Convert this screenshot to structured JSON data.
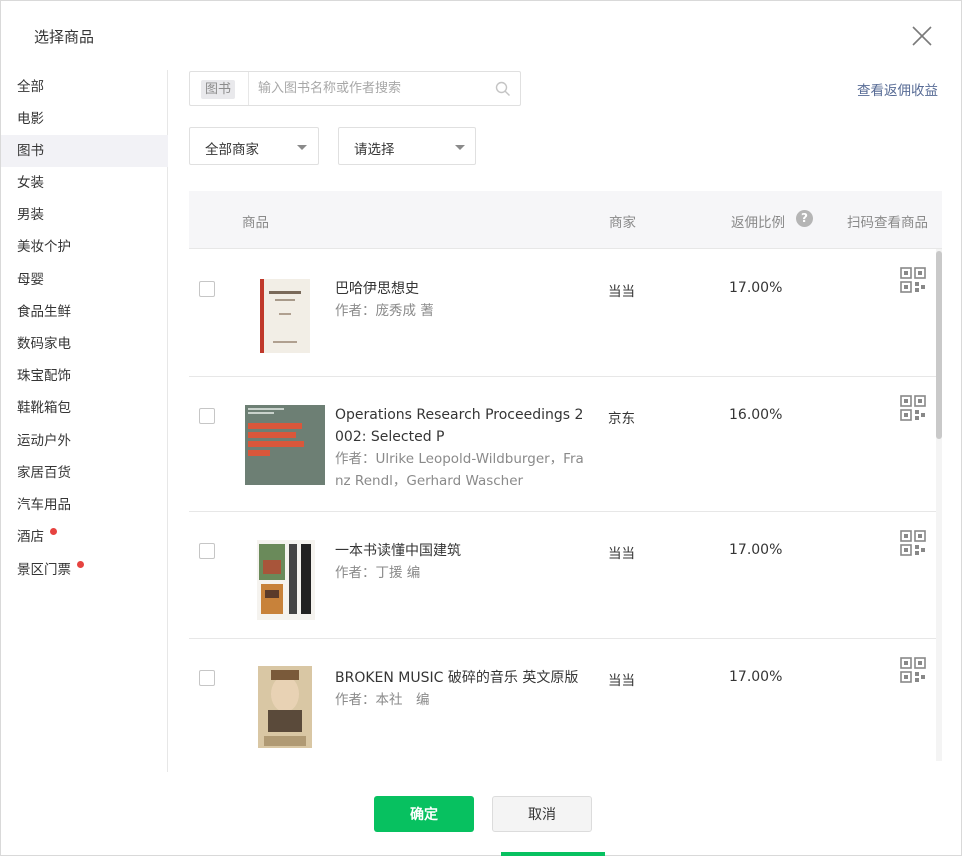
{
  "dialog": {
    "title": "选择商品",
    "confirm_label": "确定",
    "cancel_label": "取消"
  },
  "sidebar": {
    "items": [
      {
        "label": "全部",
        "active": false,
        "dot": false
      },
      {
        "label": "电影",
        "active": false,
        "dot": false
      },
      {
        "label": "图书",
        "active": true,
        "dot": false
      },
      {
        "label": "女装",
        "active": false,
        "dot": false
      },
      {
        "label": "男装",
        "active": false,
        "dot": false
      },
      {
        "label": "美妆个护",
        "active": false,
        "dot": false
      },
      {
        "label": "母婴",
        "active": false,
        "dot": false
      },
      {
        "label": "食品生鲜",
        "active": false,
        "dot": false
      },
      {
        "label": "数码家电",
        "active": false,
        "dot": false
      },
      {
        "label": "珠宝配饰",
        "active": false,
        "dot": false
      },
      {
        "label": "鞋靴箱包",
        "active": false,
        "dot": false
      },
      {
        "label": "运动户外",
        "active": false,
        "dot": false
      },
      {
        "label": "家居百货",
        "active": false,
        "dot": false
      },
      {
        "label": "汽车用品",
        "active": false,
        "dot": false
      },
      {
        "label": "酒店",
        "active": false,
        "dot": true
      },
      {
        "label": "景区门票",
        "active": false,
        "dot": true
      }
    ]
  },
  "search": {
    "tag": "图书",
    "placeholder": "输入图书名称或作者搜索",
    "value": ""
  },
  "earnings_link": "查看返佣收益",
  "filters": {
    "merchant_selected": "全部商家",
    "category_selected": "请选择"
  },
  "table": {
    "headers": {
      "product": "商品",
      "merchant": "商家",
      "ratio": "返佣比例",
      "qrcode": "扫码查看商品"
    },
    "rows": [
      {
        "name": "巴哈伊思想史",
        "author": "作者：庞秀成 蓍",
        "merchant": "当当",
        "ratio": "17.00%",
        "checked": false
      },
      {
        "name": "Operations Research Proceedings 2002: Selected P",
        "author": "作者：Ulrike Leopold-Wildburger，Franz Rendl，Gerhard Wascher",
        "merchant": "京东",
        "ratio": "16.00%",
        "checked": false,
        "cover_text": "Operations Research Proceedings 2002"
      },
      {
        "name": "一本书读懂中国建筑",
        "author": "作者：丁援 编",
        "merchant": "当当",
        "ratio": "17.00%",
        "checked": false,
        "cover_text": "一本书读懂中国建筑"
      },
      {
        "name": "BROKEN MUSIC 破碎的音乐 英文原版",
        "author": "作者：本社　编",
        "merchant": "当当",
        "ratio": "17.00%",
        "checked": false,
        "cover_text": "Sting"
      }
    ]
  },
  "colors": {
    "primary": "#07c160",
    "link": "#576b95",
    "dot": "#e64340"
  }
}
